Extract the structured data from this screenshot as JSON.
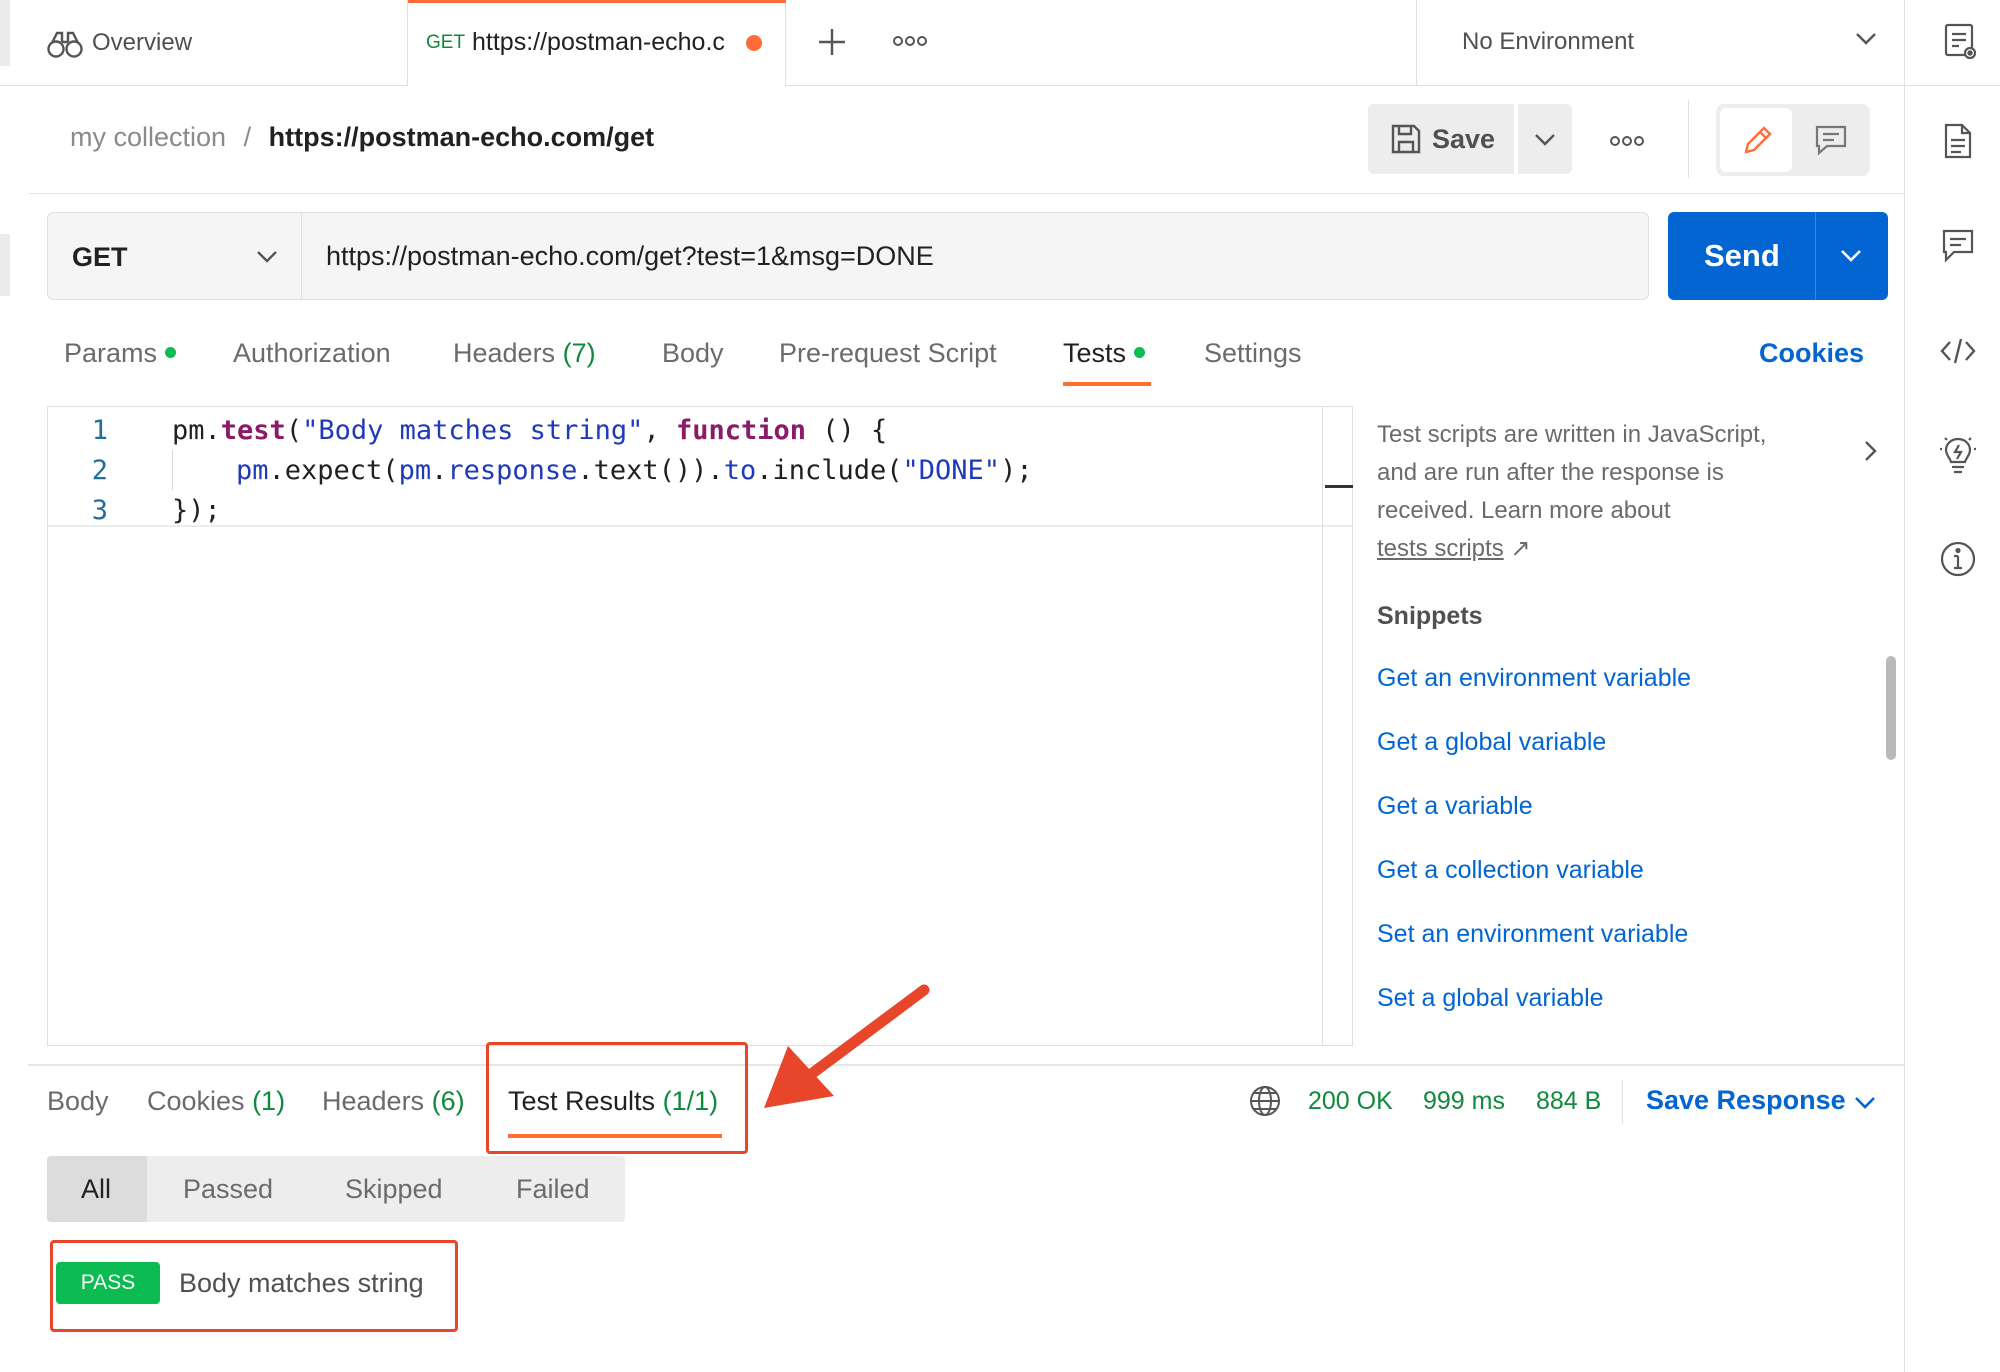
{
  "tabs": {
    "overview_label": "Overview",
    "request_method": "GET",
    "request_title": "https://postman-echo.c"
  },
  "environment": {
    "selected": "No Environment"
  },
  "breadcrumb": {
    "collection": "my collection",
    "separator": "/",
    "request": "https://postman-echo.com/get"
  },
  "toolbar": {
    "save_label": "Save"
  },
  "request": {
    "method": "GET",
    "url": "https://postman-echo.com/get?test=1&msg=DONE",
    "send_label": "Send"
  },
  "request_tabs": {
    "params": "Params",
    "authorization": "Authorization",
    "headers": "Headers",
    "headers_count": "(7)",
    "body": "Body",
    "pre_request": "Pre-request Script",
    "tests": "Tests",
    "settings": "Settings",
    "cookies": "Cookies"
  },
  "editor": {
    "line_numbers": [
      "1",
      "2",
      "3"
    ],
    "line1": {
      "a": "pm.",
      "b": "test",
      "c": "(",
      "d": "\"Body matches string\"",
      "e": ", ",
      "f": "function",
      "g": " () {"
    },
    "line2": {
      "a": "pm",
      "b": ".expect(",
      "c": "pm",
      "d": ".",
      "e": "response",
      "f": ".text()).",
      "g": "to",
      "h": ".include(",
      "i": "\"DONE\"",
      "j": ");"
    },
    "line3": "});"
  },
  "help": {
    "text_line1": "Test scripts are written in JavaScript,",
    "text_line2": "and are run after the response is",
    "text_line3": "received. Learn more about",
    "link": "tests scripts",
    "arrow": "↗",
    "snippets_title": "Snippets",
    "snippets": [
      "Get an environment variable",
      "Get a global variable",
      "Get a variable",
      "Get a collection variable",
      "Set an environment variable",
      "Set a global variable"
    ]
  },
  "response_tabs": {
    "body": "Body",
    "cookies": "Cookies",
    "cookies_count": "(1)",
    "headers": "Headers",
    "headers_count": "(6)",
    "test_results": "Test Results",
    "test_results_count": "(1/1)"
  },
  "response_meta": {
    "status": "200 OK",
    "time": "999 ms",
    "size": "884 B",
    "save_response": "Save Response"
  },
  "filters": {
    "all": "All",
    "passed": "Passed",
    "skipped": "Skipped",
    "failed": "Failed"
  },
  "result": {
    "badge": "PASS",
    "name": "Body matches string"
  },
  "colors": {
    "accent_orange": "#ff6c37",
    "send_blue": "#0265d2",
    "pass_green": "#0cbb52",
    "annotation_red": "#e8462a"
  },
  "icons": {
    "overview": "binoculars-icon",
    "new_tab": "plus-icon",
    "more": "more-icon",
    "env_dropdown": "chevron-down-icon",
    "env_quick_look": "environment-quick-look-icon",
    "save": "save-icon",
    "edit": "pencil-icon",
    "comments": "comment-icon",
    "docs": "document-icon",
    "code": "code-icon",
    "context": "lightbulb-icon",
    "info": "info-icon",
    "globe": "globe-icon"
  }
}
